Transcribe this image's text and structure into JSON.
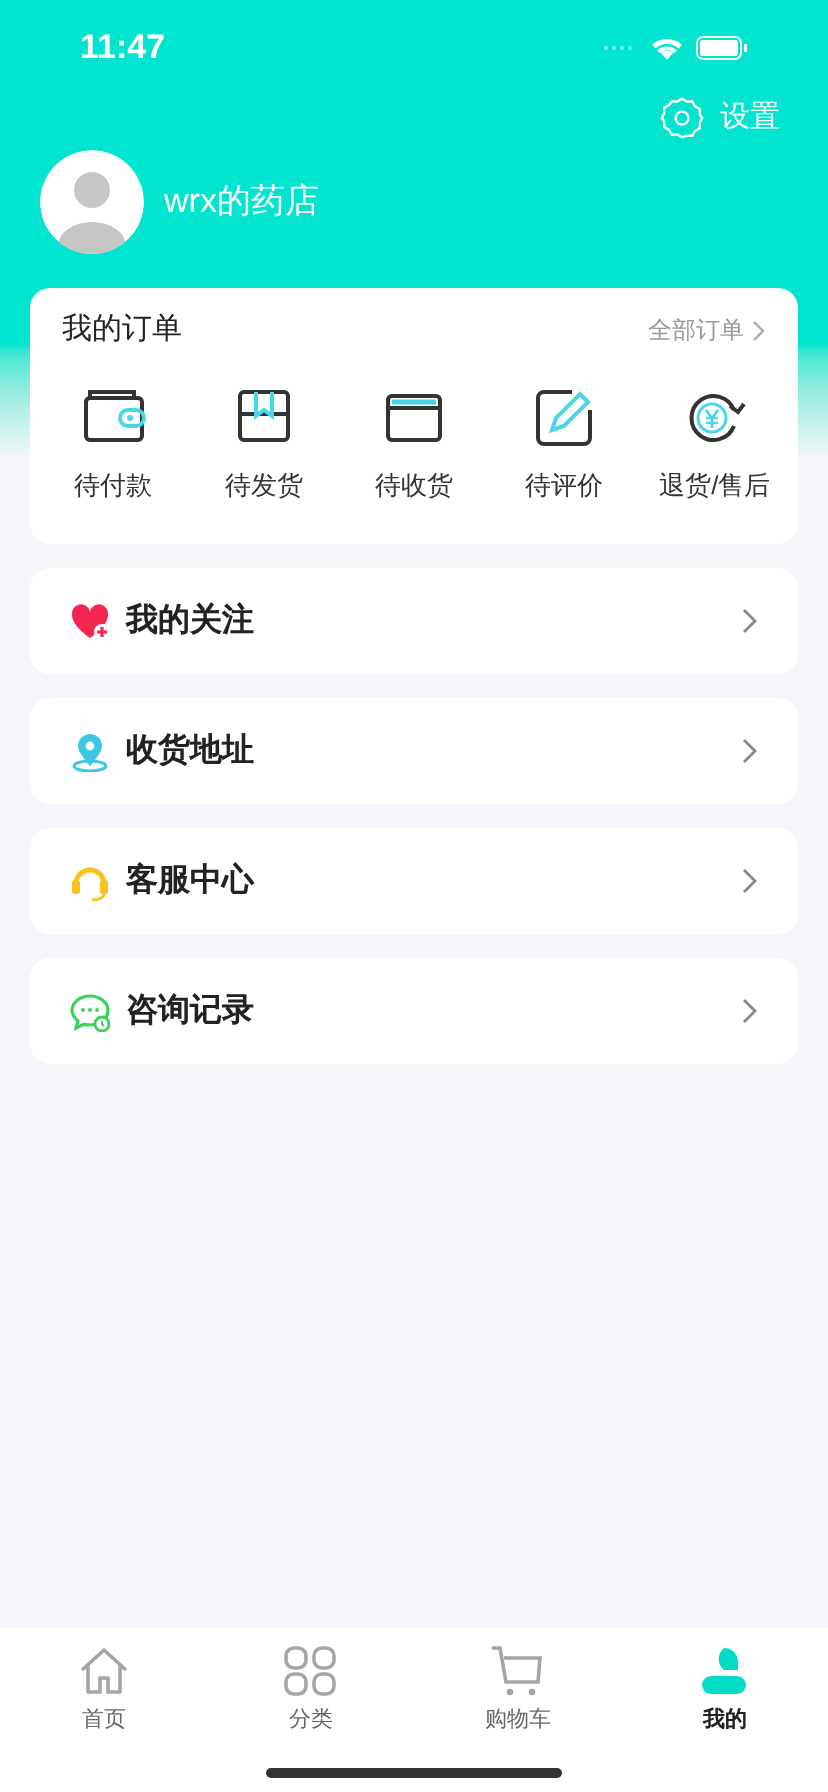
{
  "status_bar": {
    "time": "11:47"
  },
  "header": {
    "settings_label": "设置",
    "user_name": "wrx的药店"
  },
  "orders": {
    "title": "我的订单",
    "all_link": "全部订单",
    "items": [
      {
        "label": "待付款"
      },
      {
        "label": "待发货"
      },
      {
        "label": "待收货"
      },
      {
        "label": "待评价"
      },
      {
        "label": "退货/售后"
      }
    ]
  },
  "menu": [
    {
      "label": "我的关注"
    },
    {
      "label": "收货地址"
    },
    {
      "label": "客服中心"
    },
    {
      "label": "咨询记录"
    }
  ],
  "tab_bar": [
    {
      "label": "首页",
      "selected": false
    },
    {
      "label": "分类",
      "selected": false
    },
    {
      "label": "购物车",
      "selected": false
    },
    {
      "label": "我的",
      "selected": true
    }
  ]
}
